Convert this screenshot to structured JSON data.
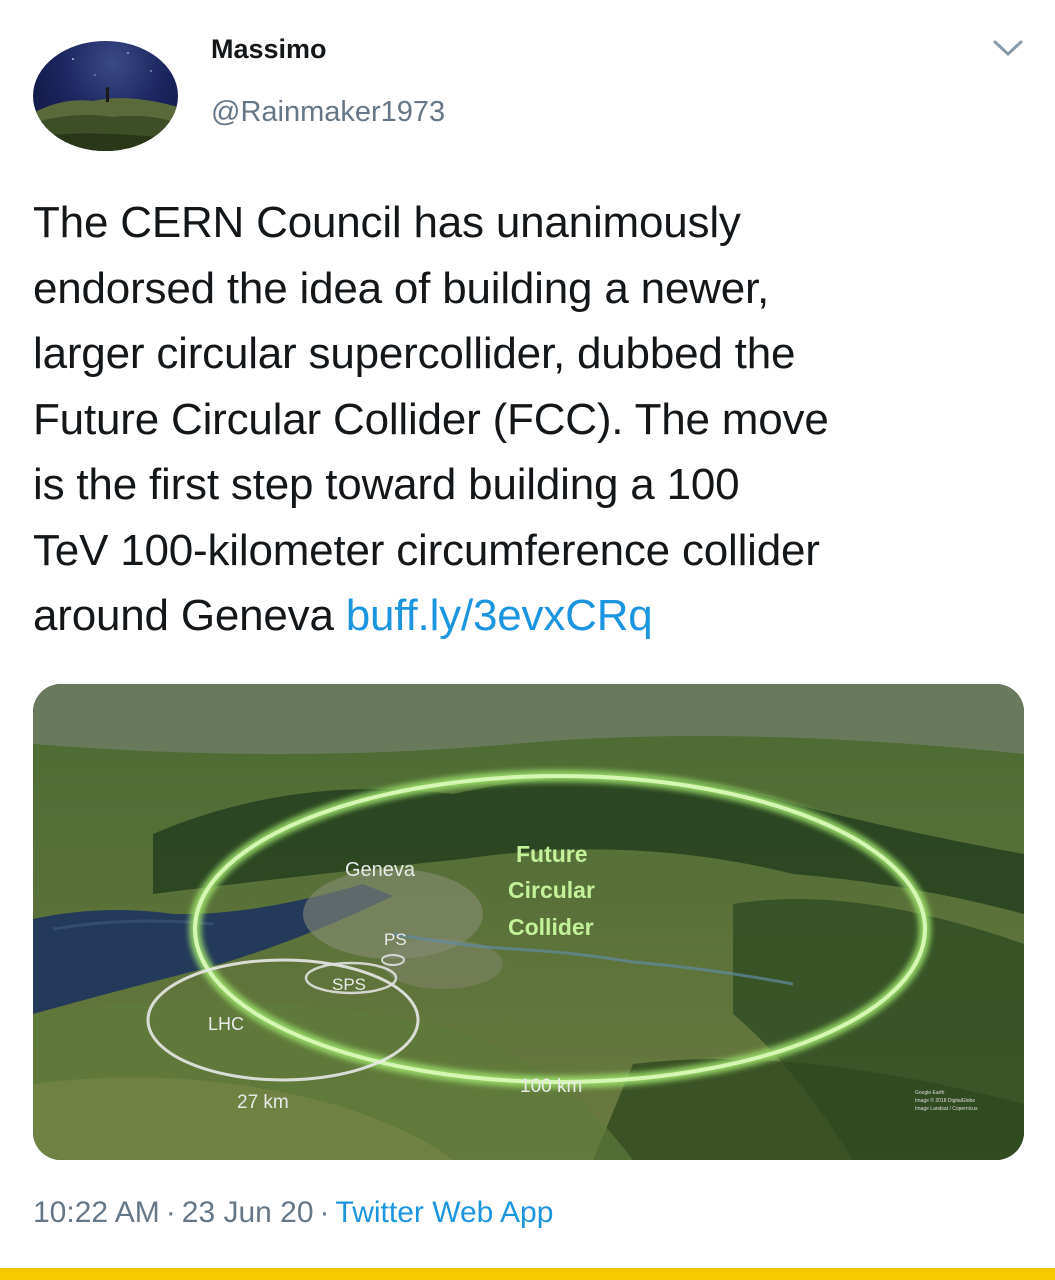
{
  "tweet": {
    "author_name": "Massimo",
    "author_handle": "@Rainmaker1973",
    "text_lines": [
      "The CERN Council has unanimously",
      "endorsed the idea of building a newer,",
      "larger circular supercollider, dubbed the",
      "Future Circular Collider (FCC). The move",
      "is the first step toward building a 100",
      "TeV 100-kilometer circumference collider",
      "around Geneva "
    ],
    "link_text": "buff.ly/3evxCRq",
    "time": "10:22 AM",
    "date": "23 Jun 20",
    "separator": "·",
    "source_app": "Twitter Web App"
  },
  "media": {
    "labels": {
      "geneva": "Geneva",
      "future": "Future",
      "circular": "Circular",
      "collider": "Collider",
      "ps": "PS",
      "sps": "SPS",
      "lhc": "LHC",
      "lhc_size": "27 km",
      "fcc_size": "100 km"
    },
    "credit_lines": [
      "Google Earth",
      "Image © 2018 DigitalGlobe",
      "Image Landsat / Copernicus"
    ]
  },
  "icons": {
    "menu": "chevron-down-icon"
  },
  "colors": {
    "link": "#1b95e0",
    "secondary_text": "#657786",
    "fcc_ring": "#b6ec8a",
    "future_label": "#c4f29a",
    "bottom_bar": "#f5c800"
  }
}
